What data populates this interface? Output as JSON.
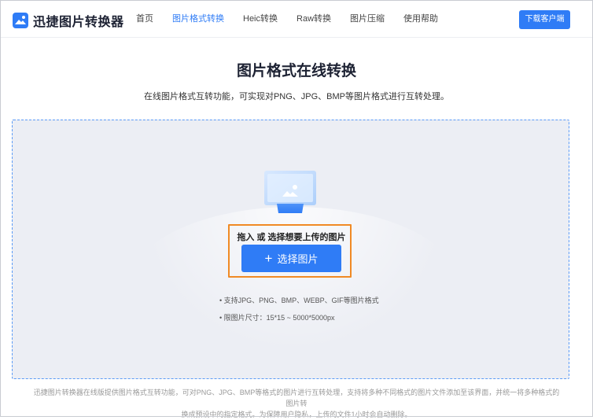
{
  "header": {
    "logo_text": "迅捷图片转换器",
    "nav": [
      {
        "label": "首页",
        "active": false
      },
      {
        "label": "图片格式转换",
        "active": true
      },
      {
        "label": "Heic转换",
        "active": false
      },
      {
        "label": "Raw转换",
        "active": false
      },
      {
        "label": "图片压缩",
        "active": false
      },
      {
        "label": "使用帮助",
        "active": false
      }
    ],
    "download_label": "下载客户端"
  },
  "main": {
    "title": "图片格式在线转换",
    "subtitle": "在线图片格式互转功能，可实现对PNG、JPG、BMP等图片格式进行互转处理。",
    "upload": {
      "drop_hint": "拖入 或 选择想要上传的图片",
      "select_button": "选择图片",
      "notes": [
        "• 支持JPG、PNG、BMP、WEBP、GIF等图片格式",
        "• 限图片尺寸：15*15 ~ 5000*5000px"
      ]
    }
  },
  "footer": {
    "line1": "迅捷图片转换器在线版提供图片格式互转功能，可对PNG、JPG、BMP等格式的图片进行互转处理，支持将多种不同格式的图片文件添加至该界面，并统一将多种格式的图片转",
    "line2": "换成预设中的指定格式。为保障用户隐私，上传的文件1小时会自动删除。"
  },
  "colors": {
    "accent": "#2f7cf6",
    "highlight": "#f08a24",
    "dropzone_bg": "#eceef4"
  }
}
